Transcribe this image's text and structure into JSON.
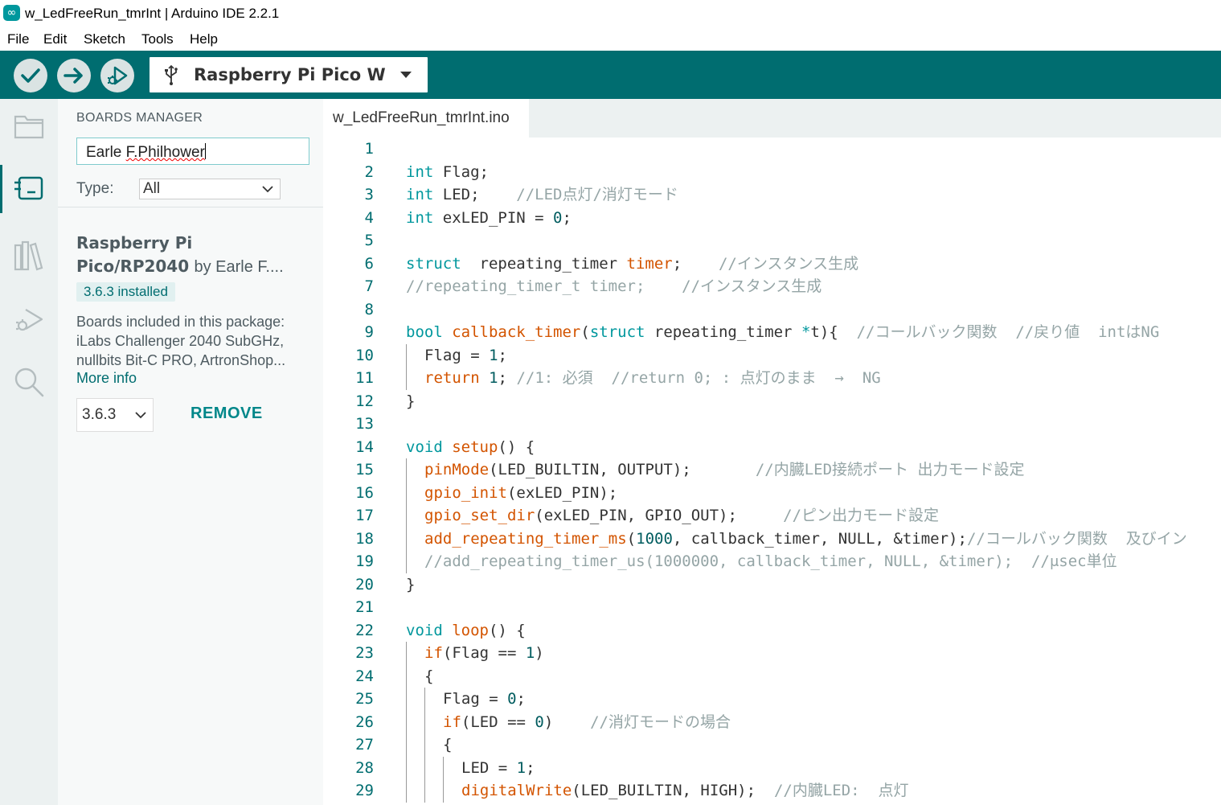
{
  "window": {
    "title": "w_LedFreeRun_tmrInt | Arduino IDE 2.2.1",
    "icon": "arduino-logo-icon"
  },
  "menu": [
    "File",
    "Edit",
    "Sketch",
    "Tools",
    "Help"
  ],
  "toolbar": {
    "board": "Raspberry Pi Pico W",
    "accent": "#006d70"
  },
  "sidebar": {
    "title": "BOARDS MANAGER",
    "search_value": "Earle F.Philhower",
    "type_label": "Type:",
    "type_value": "All",
    "package": {
      "name_line1": "Raspberry Pi",
      "name_line2": "Pico/RP2040",
      "by": "by Earle F....",
      "badge": "3.6.3 installed",
      "desc_intro": "Boards included in this package:",
      "desc_line2": "iLabs Challenger 2040 SubGHz,",
      "desc_line3": "nullbits Bit-C PRO, ArtronShop...",
      "more_info": "More info",
      "version": "3.6.3",
      "remove": "REMOVE"
    }
  },
  "editor": {
    "tab": "w_LedFreeRun_tmrInt.ino",
    "lines": [
      {
        "n": "1",
        "indent": 0,
        "t": [
          {
            "v": ""
          }
        ]
      },
      {
        "n": "2",
        "indent": 0,
        "t": [
          {
            "v": "int",
            "c": "k"
          },
          {
            "v": " Flag;"
          }
        ]
      },
      {
        "n": "3",
        "indent": 0,
        "t": [
          {
            "v": "int",
            "c": "k"
          },
          {
            "v": " LED;    "
          },
          {
            "v": "//LED点灯/消灯モード",
            "c": "c"
          }
        ]
      },
      {
        "n": "4",
        "indent": 0,
        "t": [
          {
            "v": "int",
            "c": "k"
          },
          {
            "v": " exLED_PIN = "
          },
          {
            "v": "0",
            "c": "n"
          },
          {
            "v": ";"
          }
        ]
      },
      {
        "n": "5",
        "indent": 0,
        "t": [
          {
            "v": ""
          }
        ]
      },
      {
        "n": "6",
        "indent": 0,
        "t": [
          {
            "v": "struct",
            "c": "k"
          },
          {
            "v": "  repeating_timer "
          },
          {
            "v": "timer",
            "c": "f"
          },
          {
            "v": ";    "
          },
          {
            "v": "//インスタンス生成",
            "c": "c"
          }
        ]
      },
      {
        "n": "7",
        "indent": 0,
        "t": [
          {
            "v": "//repeating_timer_t timer;    //インスタンス生成",
            "c": "c"
          }
        ]
      },
      {
        "n": "8",
        "indent": 0,
        "t": [
          {
            "v": ""
          }
        ]
      },
      {
        "n": "9",
        "indent": 0,
        "t": [
          {
            "v": "bool",
            "c": "k"
          },
          {
            "v": " "
          },
          {
            "v": "callback_timer",
            "c": "f"
          },
          {
            "v": "("
          },
          {
            "v": "struct",
            "c": "k"
          },
          {
            "v": " repeating_timer "
          },
          {
            "v": "*",
            "c": "k"
          },
          {
            "v": "t){  "
          },
          {
            "v": "//コールバック関数  //戻り値  intはNG",
            "c": "c"
          }
        ]
      },
      {
        "n": "10",
        "indent": 1,
        "t": [
          {
            "v": "Flag = "
          },
          {
            "v": "1",
            "c": "n"
          },
          {
            "v": ";"
          }
        ]
      },
      {
        "n": "11",
        "indent": 1,
        "t": [
          {
            "v": "return",
            "c": "f"
          },
          {
            "v": " "
          },
          {
            "v": "1",
            "c": "n"
          },
          {
            "v": "; "
          },
          {
            "v": "//1: 必須  //return 0; : 点灯のまま  →  NG",
            "c": "c"
          }
        ]
      },
      {
        "n": "12",
        "indent": 0,
        "t": [
          {
            "v": "}"
          }
        ]
      },
      {
        "n": "13",
        "indent": 0,
        "t": [
          {
            "v": ""
          }
        ]
      },
      {
        "n": "14",
        "indent": 0,
        "t": [
          {
            "v": "void",
            "c": "k"
          },
          {
            "v": " "
          },
          {
            "v": "setup",
            "c": "f"
          },
          {
            "v": "() {"
          }
        ]
      },
      {
        "n": "15",
        "indent": 1,
        "t": [
          {
            "v": "pinMode",
            "c": "f"
          },
          {
            "v": "(LED_BUILTIN, OUTPUT);       "
          },
          {
            "v": "//内臓LED接続ポート 出力モード設定",
            "c": "c"
          }
        ]
      },
      {
        "n": "16",
        "indent": 1,
        "t": [
          {
            "v": "gpio_init",
            "c": "f"
          },
          {
            "v": "(exLED_PIN);"
          }
        ]
      },
      {
        "n": "17",
        "indent": 1,
        "t": [
          {
            "v": "gpio_set_dir",
            "c": "f"
          },
          {
            "v": "(exLED_PIN, GPIO_OUT);     "
          },
          {
            "v": "//ピン出力モード設定",
            "c": "c"
          }
        ]
      },
      {
        "n": "18",
        "indent": 1,
        "t": [
          {
            "v": "add_repeating_timer_ms",
            "c": "f"
          },
          {
            "v": "("
          },
          {
            "v": "1000",
            "c": "n"
          },
          {
            "v": ", callback_timer, NULL, &timer);"
          },
          {
            "v": "//コールバック関数  及びイン",
            "c": "c"
          }
        ]
      },
      {
        "n": "19",
        "indent": 1,
        "t": [
          {
            "v": "//add_repeating_timer_us(1000000, callback_timer, NULL, &timer);  //μsec単位",
            "c": "c"
          }
        ]
      },
      {
        "n": "20",
        "indent": 0,
        "t": [
          {
            "v": "}"
          }
        ]
      },
      {
        "n": "21",
        "indent": 0,
        "t": [
          {
            "v": ""
          }
        ]
      },
      {
        "n": "22",
        "indent": 0,
        "t": [
          {
            "v": "void",
            "c": "k"
          },
          {
            "v": " "
          },
          {
            "v": "loop",
            "c": "f"
          },
          {
            "v": "() {"
          }
        ]
      },
      {
        "n": "23",
        "indent": 1,
        "t": [
          {
            "v": "if",
            "c": "f"
          },
          {
            "v": "(Flag == "
          },
          {
            "v": "1",
            "c": "n"
          },
          {
            "v": ")"
          }
        ]
      },
      {
        "n": "24",
        "indent": 1,
        "t": [
          {
            "v": "{"
          }
        ]
      },
      {
        "n": "25",
        "indent": 2,
        "t": [
          {
            "v": "Flag = "
          },
          {
            "v": "0",
            "c": "n"
          },
          {
            "v": ";"
          }
        ]
      },
      {
        "n": "26",
        "indent": 2,
        "t": [
          {
            "v": "if",
            "c": "f"
          },
          {
            "v": "(LED == "
          },
          {
            "v": "0",
            "c": "n"
          },
          {
            "v": ")    "
          },
          {
            "v": "//消灯モードの場合",
            "c": "c"
          }
        ]
      },
      {
        "n": "27",
        "indent": 2,
        "t": [
          {
            "v": "{"
          }
        ]
      },
      {
        "n": "28",
        "indent": 3,
        "t": [
          {
            "v": "LED = "
          },
          {
            "v": "1",
            "c": "n"
          },
          {
            "v": ";"
          }
        ]
      },
      {
        "n": "29",
        "indent": 3,
        "t": [
          {
            "v": "digitalWrite",
            "c": "f"
          },
          {
            "v": "(LED_BUILTIN, HIGH);  "
          },
          {
            "v": "//内臓LED:  点灯",
            "c": "c"
          }
        ]
      }
    ]
  }
}
